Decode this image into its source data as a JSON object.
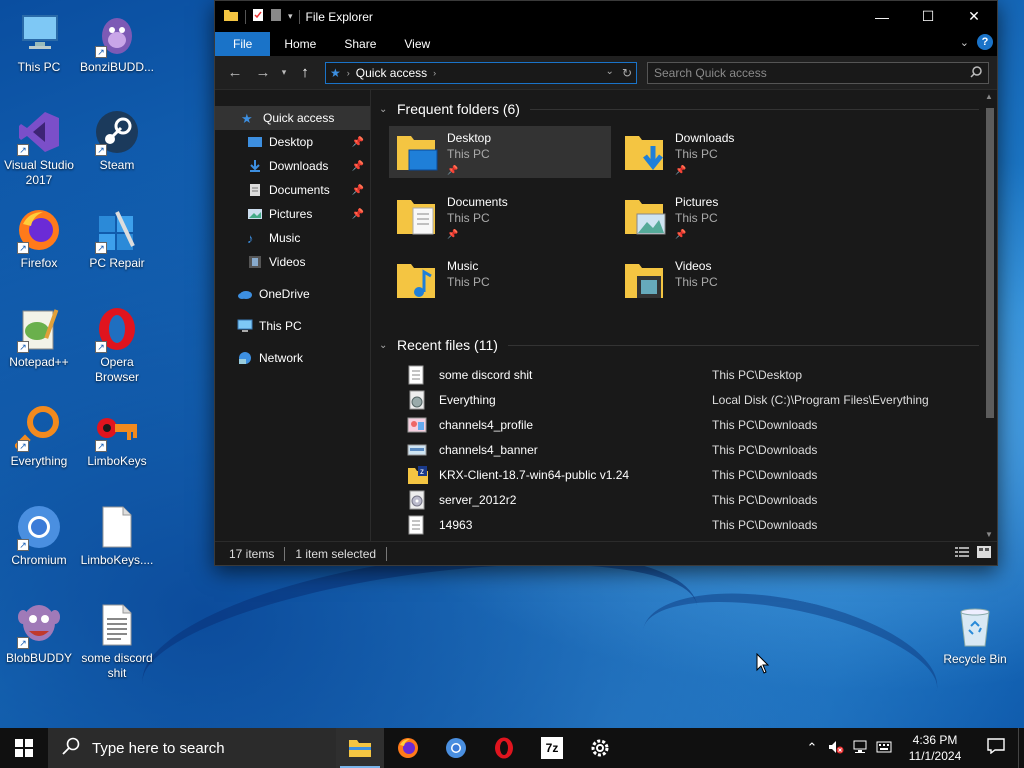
{
  "window": {
    "title": "File Explorer",
    "tabs": [
      "File",
      "Home",
      "Share",
      "View"
    ],
    "controls": {
      "minimize": "—",
      "maximize": "☐",
      "close": "✕"
    }
  },
  "address": {
    "location": "Quick access",
    "search_placeholder": "Search Quick access"
  },
  "nav_pane": {
    "quick_access": "Quick access",
    "pinned": [
      "Desktop",
      "Downloads",
      "Documents",
      "Pictures"
    ],
    "unpinned": [
      "Music",
      "Videos"
    ],
    "onedrive": "OneDrive",
    "this_pc": "This PC",
    "network": "Network"
  },
  "frequent": {
    "header": "Frequent folders (6)",
    "folders": [
      {
        "name": "Desktop",
        "location": "This PC"
      },
      {
        "name": "Downloads",
        "location": "This PC"
      },
      {
        "name": "Documents",
        "location": "This PC"
      },
      {
        "name": "Pictures",
        "location": "This PC"
      },
      {
        "name": "Music",
        "location": "This PC"
      },
      {
        "name": "Videos",
        "location": "This PC"
      }
    ]
  },
  "recent": {
    "header": "Recent files (11)",
    "files": [
      {
        "name": "some discord shit",
        "path": "This PC\\Desktop"
      },
      {
        "name": "Everything",
        "path": "Local Disk (C:)\\Program Files\\Everything"
      },
      {
        "name": "channels4_profile",
        "path": "This PC\\Downloads"
      },
      {
        "name": "channels4_banner",
        "path": "This PC\\Downloads"
      },
      {
        "name": "KRX-Client-18.7-win64-public v1.24",
        "path": "This PC\\Downloads"
      },
      {
        "name": "server_2012r2",
        "path": "This PC\\Downloads"
      },
      {
        "name": "14963",
        "path": "This PC\\Downloads"
      }
    ]
  },
  "status": {
    "items": "17 items",
    "selected": "1 item selected"
  },
  "desktop_icons": [
    {
      "label": "This PC"
    },
    {
      "label": "BonziBUDD..."
    },
    {
      "label": "Visual Studio 2017"
    },
    {
      "label": "Steam"
    },
    {
      "label": "Firefox"
    },
    {
      "label": "PC Repair"
    },
    {
      "label": "Notepad++"
    },
    {
      "label": "Opera Browser"
    },
    {
      "label": "Everything"
    },
    {
      "label": "LimboKeys"
    },
    {
      "label": "Chromium"
    },
    {
      "label": "LimboKeys...."
    },
    {
      "label": "BlobBUDDY"
    },
    {
      "label": "some discord shit"
    },
    {
      "label": "Recycle Bin"
    }
  ],
  "taskbar": {
    "search_placeholder": "Type here to search",
    "clock_time": "4:36 PM",
    "clock_date": "11/1/2024",
    "apps": [
      "file-explorer",
      "firefox",
      "chromium",
      "opera",
      "7-zip",
      "settings"
    ],
    "tray_7zip_label": "7z"
  },
  "colors": {
    "accent": "#1a73c8",
    "window_bg": "#191919",
    "taskbar_bg": "#101010"
  }
}
